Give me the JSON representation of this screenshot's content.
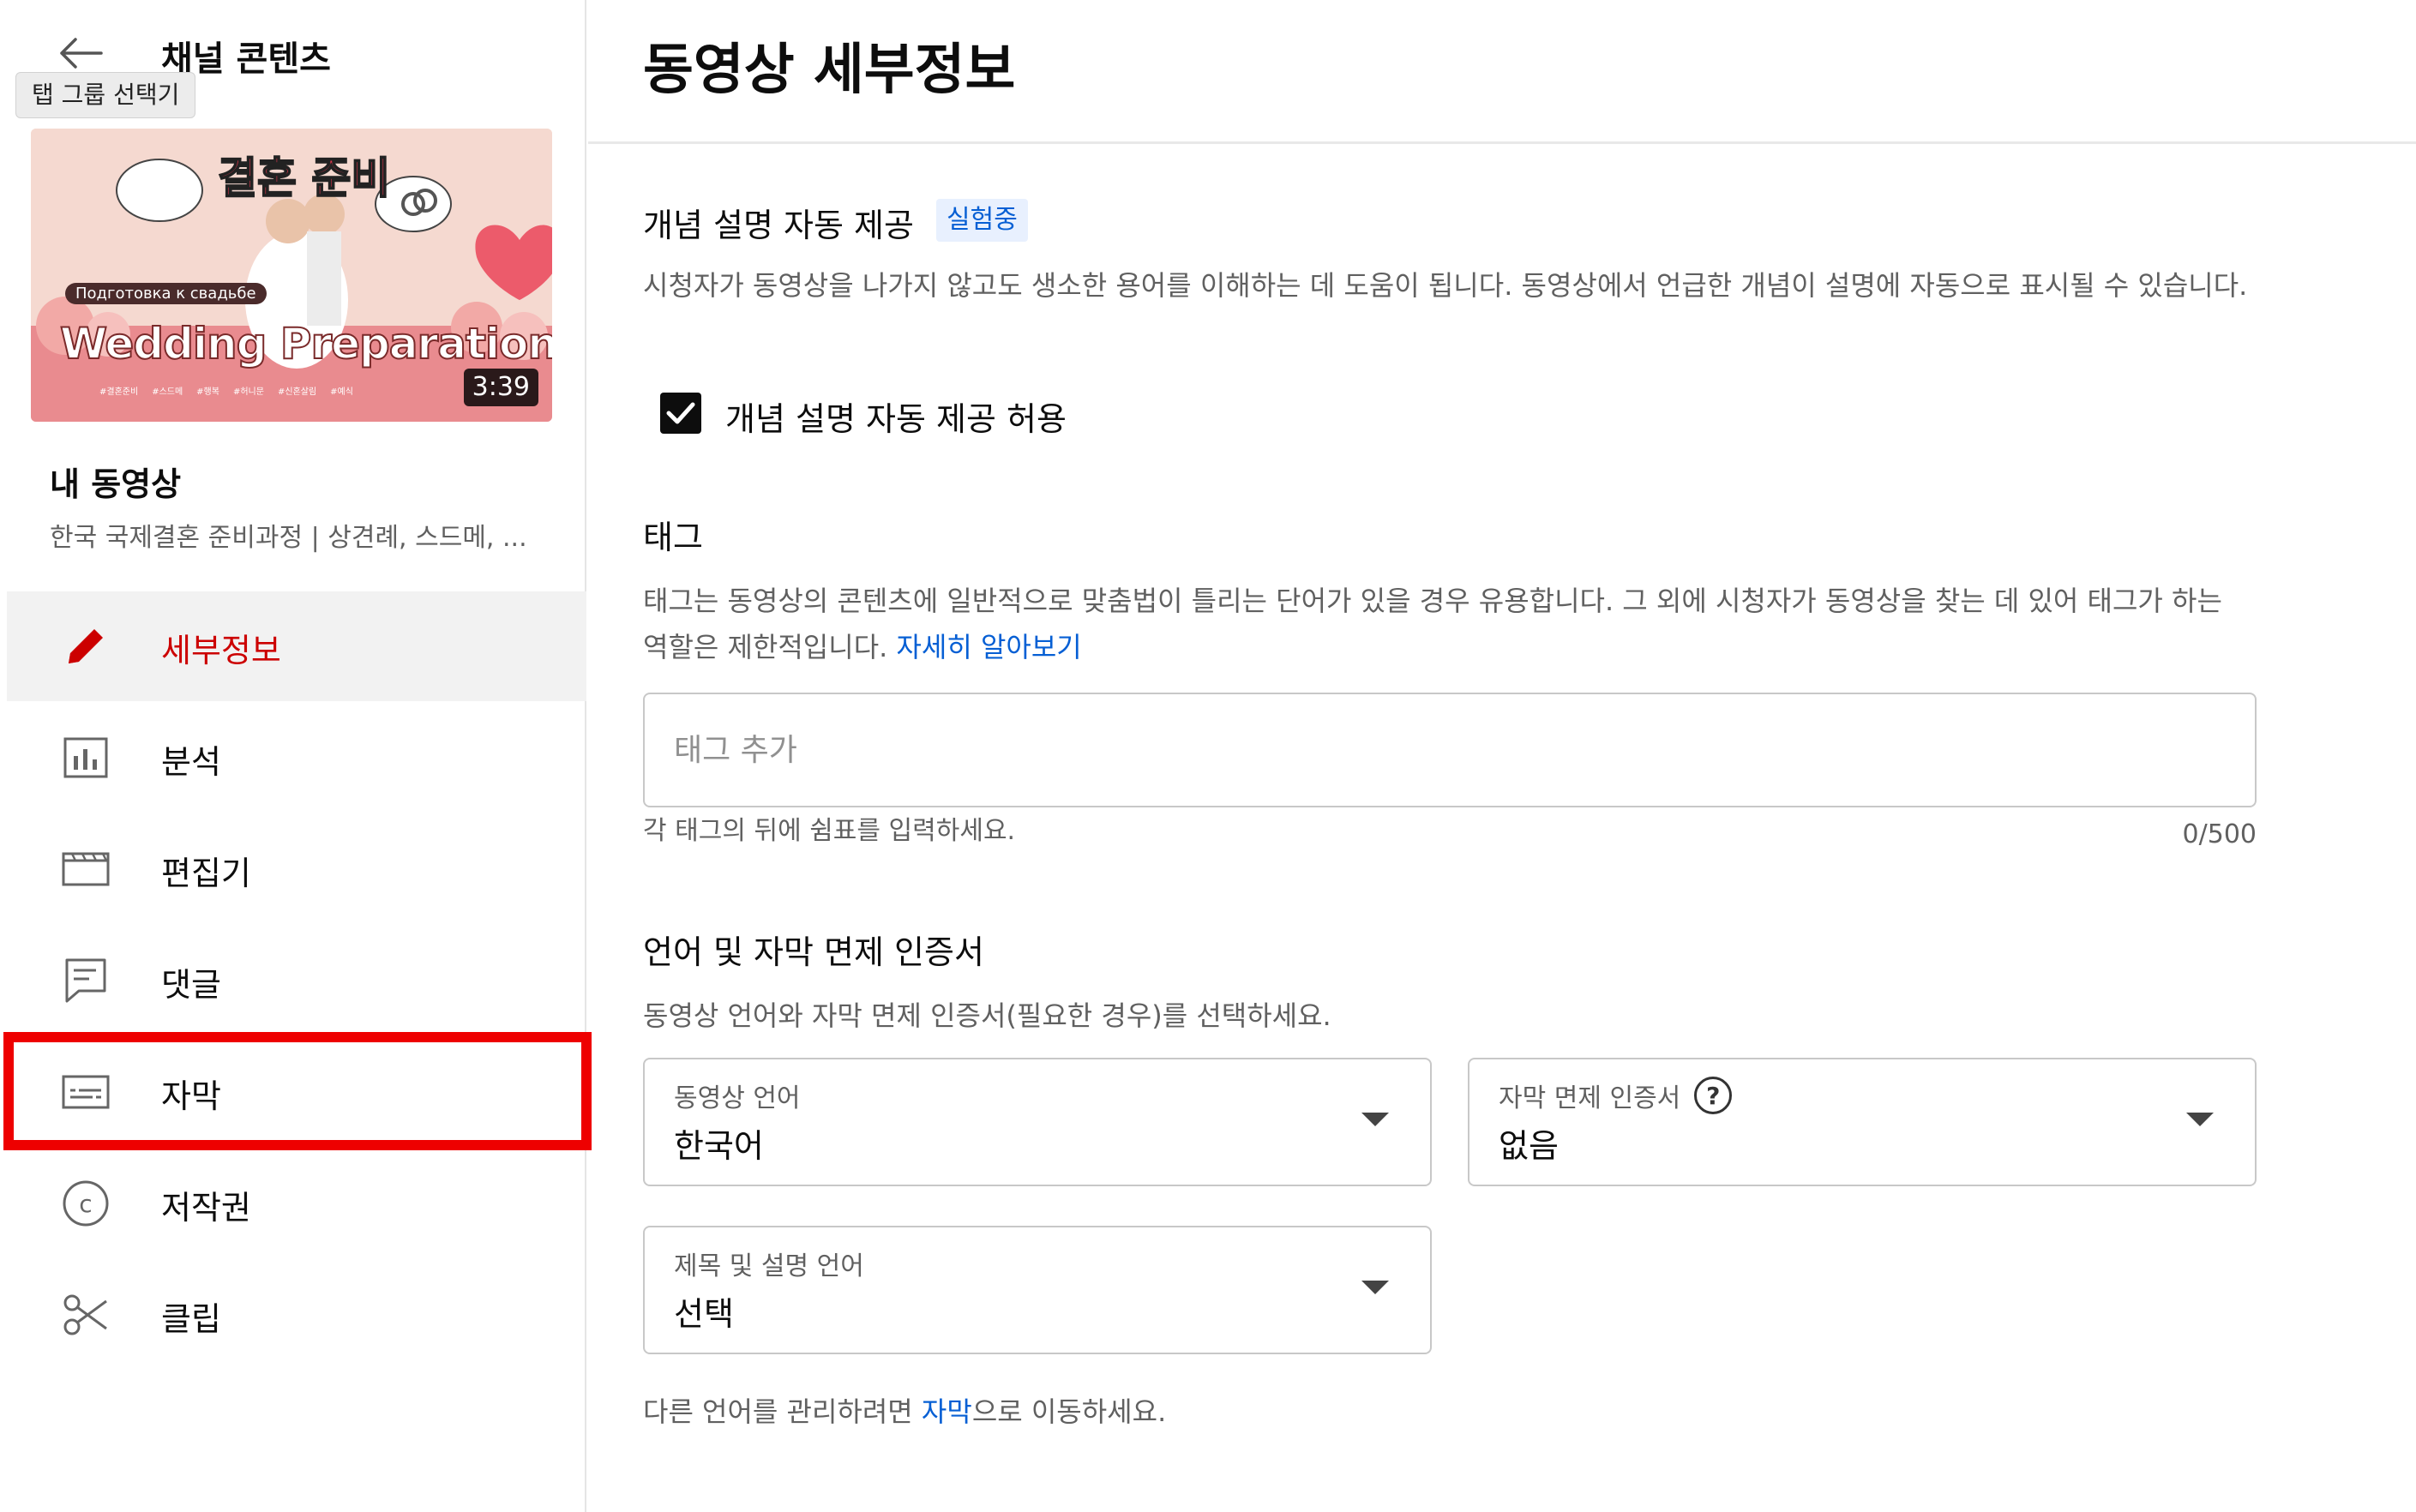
{
  "sidebar": {
    "channel_title": "채널 콘텐츠",
    "tooltip": "탭 그룹 선택기",
    "thumbnail": {
      "title_ko": "결혼 준비",
      "subtitle": "Подготовка к свадьбе",
      "title_en": "Wedding Preparation",
      "duration": "3:39",
      "hashtags": [
        "#결혼준비",
        "#스드메",
        "#행복",
        "#허니문",
        "#신혼살림",
        "#예식"
      ]
    },
    "my_videos_label": "내 동영상",
    "video_title": "한국 국제결혼 준비과정 | 상견례, 스드메, ...",
    "nav": [
      {
        "id": "details",
        "label": "세부정보",
        "icon": "pencil-icon",
        "active": true
      },
      {
        "id": "analytics",
        "label": "분석",
        "icon": "bar-chart-icon",
        "active": false
      },
      {
        "id": "editor",
        "label": "편집기",
        "icon": "film-strip-icon",
        "active": false
      },
      {
        "id": "comments",
        "label": "댓글",
        "icon": "comment-icon",
        "active": false
      },
      {
        "id": "subtitles",
        "label": "자막",
        "icon": "subtitles-icon",
        "active": false
      },
      {
        "id": "copyright",
        "label": "저작권",
        "icon": "copyright-icon",
        "active": false
      },
      {
        "id": "clips",
        "label": "클립",
        "icon": "scissors-icon",
        "active": false
      }
    ],
    "highlight_color": "#ee0000"
  },
  "main": {
    "page_title": "동영상 세부정보",
    "concepts": {
      "title": "개념 설명 자동 제공",
      "badge": "실험중",
      "description": "시청자가 동영상을 나가지 않고도 생소한 용어를 이해하는 데 도움이 됩니다. 동영상에서 언급한 개념이 설명에 자동으로 표시될 수 있습니다.",
      "checkbox_label": "개념 설명 자동 제공 허용",
      "checked": true
    },
    "tags": {
      "title": "태그",
      "description": "태그는 동영상의 콘텐츠에 일반적으로 맞춤법이 틀리는 단어가 있을 경우 유용합니다. 그 외에 시청자가 동영상을 찾는 데 있어 태그가 하는 역할은 제한적입니다. ",
      "learn_more": "자세히 알아보기",
      "input_value": "",
      "input_placeholder": "태그 추가",
      "hint": "각 태그의 뒤에 쉼표를 입력하세요.",
      "counter": "0/500"
    },
    "language": {
      "title": "언어 및 자막 면제 인증서",
      "description": "동영상 언어와 자막 면제 인증서(필요한 경우)를 선택하세요.",
      "video_language": {
        "label": "동영상 언어",
        "value": "한국어"
      },
      "caption_cert": {
        "label": "자막 면제 인증서",
        "value": "없음"
      },
      "title_desc_language": {
        "label": "제목 및 설명 언어",
        "value": "선택"
      },
      "manage_prefix": "다른 언어를 관리하려면 ",
      "manage_link": "자막",
      "manage_suffix": "으로 이동하세요."
    }
  },
  "colors": {
    "accent_red": "#cc0000",
    "link_blue": "#065fd4",
    "badge_bg": "#e8f0fe"
  }
}
